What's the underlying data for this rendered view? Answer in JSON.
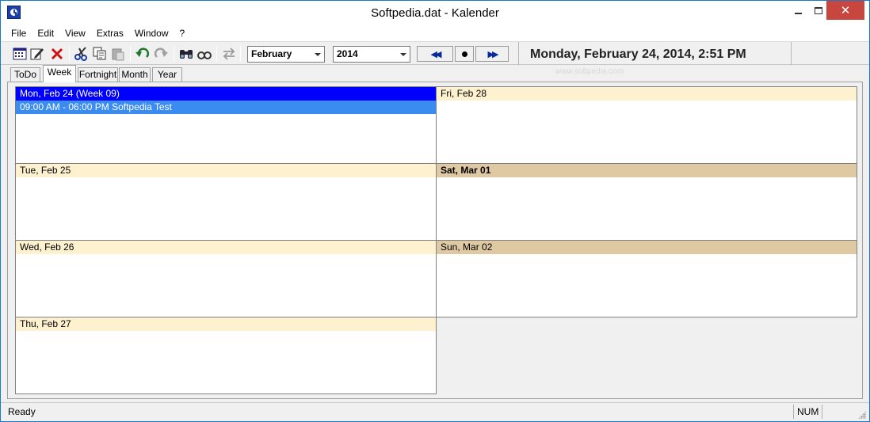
{
  "window": {
    "title": "Softpedia.dat - Kalender",
    "icon": "calendar-clock-icon",
    "controls": {
      "minimize": "minimize-icon",
      "maximize": "maximize-icon",
      "close": "✕"
    }
  },
  "menu": {
    "items": [
      {
        "label": "File"
      },
      {
        "label": "Edit"
      },
      {
        "label": "View"
      },
      {
        "label": "Extras"
      },
      {
        "label": "Window"
      },
      {
        "label": "?"
      }
    ]
  },
  "toolbar": {
    "icons": [
      "calendar-view-icon",
      "edit-icon",
      "delete-icon",
      "cut-icon",
      "copy-icon",
      "paste-icon",
      "undo-icon",
      "redo-icon",
      "find-icon",
      "find-next-icon",
      "swap-icon"
    ],
    "month_value": "February",
    "year_value": "2014",
    "nav": {
      "prev": "◀◀",
      "today": "●",
      "next": "▶▶"
    },
    "datetime": "Monday, February 24, 2014, 2:51 PM"
  },
  "tabs": [
    {
      "label": "ToDo"
    },
    {
      "label": "Week",
      "active": true
    },
    {
      "label": "Fortnight"
    },
    {
      "label": "Month"
    },
    {
      "label": "Year"
    }
  ],
  "watermark": "www.softpedia.com",
  "week": {
    "days": [
      {
        "label": "Mon, Feb 24 (Week 09)",
        "style": "today",
        "events": [
          "09:00 AM - 06:00 PM Softpedia Test"
        ]
      },
      {
        "label": "Tue, Feb 25",
        "style": "weekday",
        "events": []
      },
      {
        "label": "Wed, Feb 26",
        "style": "weekday",
        "events": []
      },
      {
        "label": "Thu, Feb 27",
        "style": "weekday",
        "events": []
      },
      {
        "label": "Fri, Feb 28",
        "style": "weekday",
        "events": []
      },
      {
        "label": "Sat, Mar 01",
        "style": "weekend-bold",
        "events": []
      },
      {
        "label": "Sun, Mar 02",
        "style": "weekend",
        "events": []
      }
    ]
  },
  "colors": {
    "today_header": "#0000ff",
    "event_bar": "#3a8cf0",
    "weekday_header": "#fdf1cf",
    "weekend_header": "#dfc9a3"
  },
  "status": {
    "text": "Ready",
    "num": "NUM"
  }
}
